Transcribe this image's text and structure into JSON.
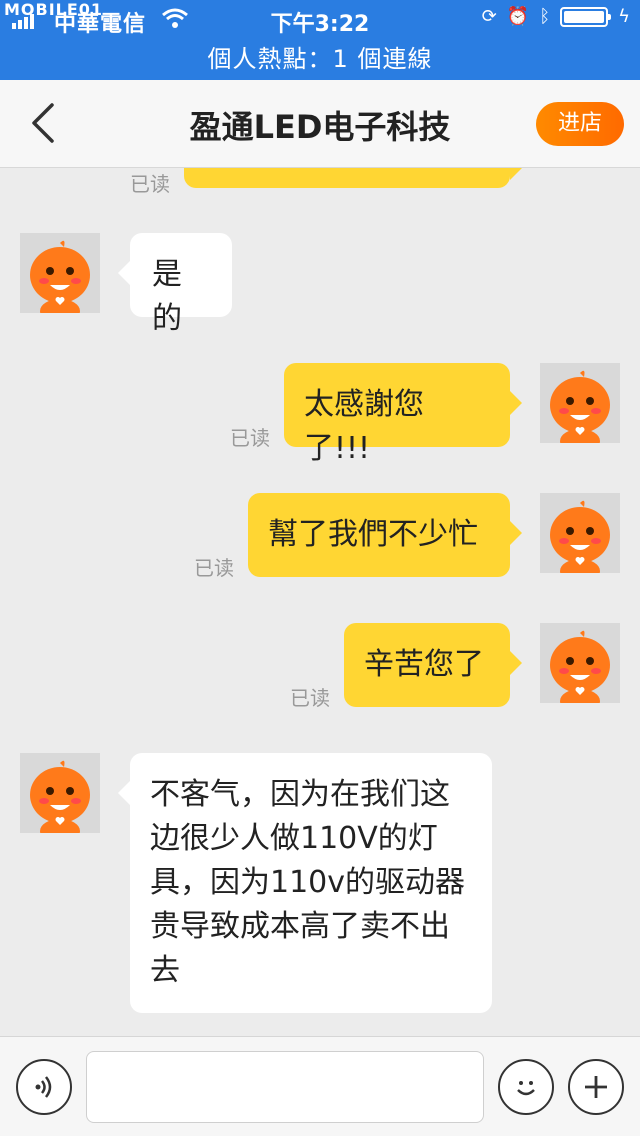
{
  "status_bar": {
    "logo": "MOBILE01",
    "carrier": "中華電信",
    "time": "下午3:22"
  },
  "hotspot_text": "個人熱點：1 個連線",
  "nav": {
    "title": "盈通LED电子科技",
    "store_button": "进店"
  },
  "messages": [
    {
      "side": "right",
      "text": "",
      "read": "已读"
    },
    {
      "side": "left",
      "text": "是的"
    },
    {
      "side": "right",
      "text": "太感謝您了!!!",
      "read": "已读"
    },
    {
      "side": "right",
      "text": "幫了我們不少忙",
      "read": "已读"
    },
    {
      "side": "right",
      "text": "辛苦您了",
      "read": "已读"
    },
    {
      "side": "left",
      "text_lines": [
        "不客气，因为在我们这",
        "边很少人做110V的灯",
        "具，因为110v的驱动器",
        "贵导致成本高了卖不出",
        "去"
      ]
    }
  ],
  "input": {
    "voice_icon": "voice-icon",
    "emoji_icon": "emoji-icon",
    "plus_icon": "plus-icon"
  }
}
